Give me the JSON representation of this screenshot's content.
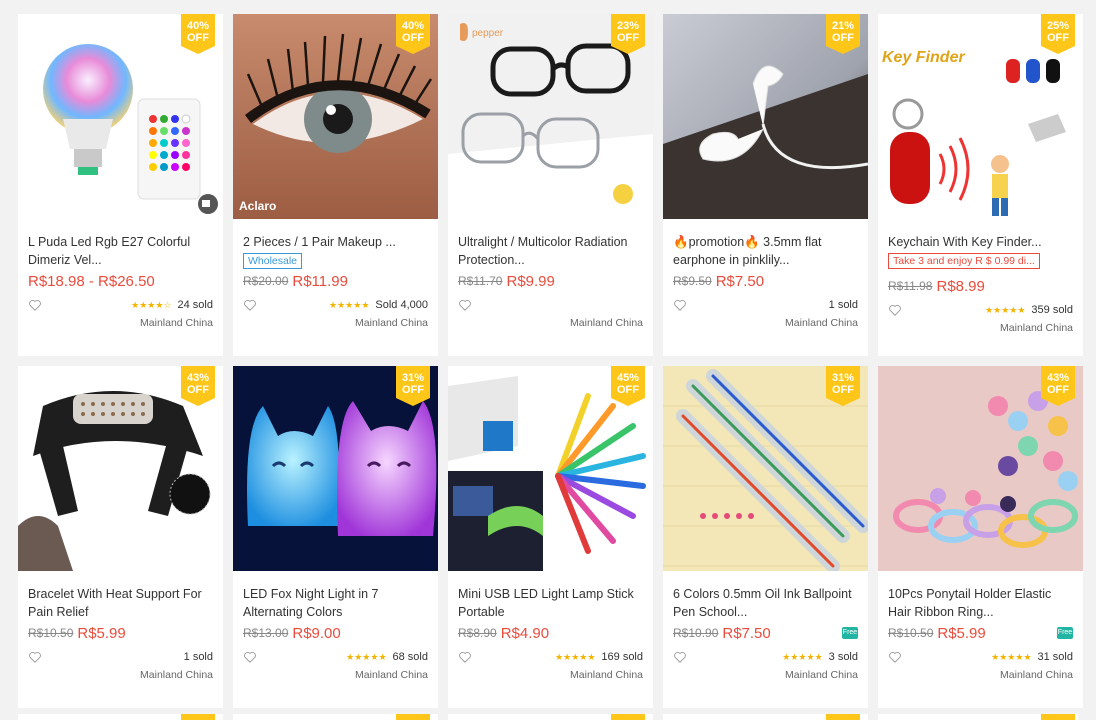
{
  "products": [
    {
      "discount_pct": "40%",
      "off": "OFF",
      "title": "L Puda Led Rgb E27 Colorful Dimeriz Vel...",
      "tag": "",
      "tag_style": "",
      "old_price": "",
      "price": "R$18.98 - R$26.50",
      "stars": "★★★★☆",
      "sold": "24 sold",
      "location": "Mainland China",
      "free_shipping": false
    },
    {
      "discount_pct": "40%",
      "off": "OFF",
      "title": "2 Pieces / 1 Pair Makeup ...",
      "tag": "Wholesale",
      "tag_style": "blue",
      "old_price": "R$20.00",
      "price": "R$11.99",
      "stars": "★★★★★",
      "sold": "Sold 4,000",
      "location": "Mainland China",
      "free_shipping": false
    },
    {
      "discount_pct": "23%",
      "off": "OFF",
      "title": "Ultralight / Multicolor Radiation Protection...",
      "tag": "",
      "tag_style": "",
      "old_price": "R$11.70",
      "price": "R$9.99",
      "stars": "",
      "sold": "",
      "location": "Mainland China",
      "free_shipping": false
    },
    {
      "discount_pct": "21%",
      "off": "OFF",
      "title": "🔥promotion🔥 3.5mm flat earphone in pinklily...",
      "tag": "",
      "tag_style": "",
      "old_price": "R$9.50",
      "price": "R$7.50",
      "stars": "",
      "sold": "1 sold",
      "location": "Mainland China",
      "free_shipping": false
    },
    {
      "discount_pct": "25%",
      "off": "OFF",
      "title": "Keychain With Key Finder...",
      "tag": "Take 3 and enjoy R $ 0.99 di...",
      "tag_style": "red",
      "old_price": "R$11.98",
      "price": "R$8.99",
      "stars": "★★★★★",
      "sold": "359 sold",
      "location": "Mainland China",
      "free_shipping": false
    },
    {
      "discount_pct": "43%",
      "off": "OFF",
      "title": "Bracelet With Heat Support For Pain Relief",
      "tag": "",
      "tag_style": "",
      "old_price": "R$10.50",
      "price": "R$5.99",
      "stars": "",
      "sold": "1 sold",
      "location": "Mainland China",
      "free_shipping": false
    },
    {
      "discount_pct": "31%",
      "off": "OFF",
      "title": "LED Fox Night Light in 7 Alternating Colors",
      "tag": "",
      "tag_style": "",
      "old_price": "R$13.00",
      "price": "R$9.00",
      "stars": "★★★★★",
      "sold": "68 sold",
      "location": "Mainland China",
      "free_shipping": false
    },
    {
      "discount_pct": "45%",
      "off": "OFF",
      "title": "Mini USB LED Light Lamp Stick Portable",
      "tag": "",
      "tag_style": "",
      "old_price": "R$8.90",
      "price": "R$4.90",
      "stars": "★★★★★",
      "sold": "169 sold",
      "location": "Mainland China",
      "free_shipping": false
    },
    {
      "discount_pct": "31%",
      "off": "OFF",
      "title": "6 Colors 0.5mm Oil Ink Ballpoint Pen School...",
      "tag": "",
      "tag_style": "",
      "old_price": "R$10.90",
      "price": "R$7.50",
      "stars": "★★★★★",
      "sold": "3 sold",
      "location": "Mainland China",
      "free_shipping": true
    },
    {
      "discount_pct": "43%",
      "off": "OFF",
      "title": "10Pcs Ponytail Holder Elastic Hair Ribbon Ring...",
      "tag": "",
      "tag_style": "",
      "old_price": "R$10.50",
      "price": "R$5.99",
      "stars": "★★★★★",
      "sold": "31 sold",
      "location": "Mainland China",
      "free_shipping": true
    }
  ],
  "free_shipping_label": "Free",
  "image_overlays": {
    "lashes_brand": "Aclaro",
    "glasses_brand": "pepper",
    "keyfinder_title": "Key Finder"
  },
  "colors": {
    "accent": "#e94c3d",
    "badge": "#ffc61a",
    "stars": "#f5b301"
  }
}
